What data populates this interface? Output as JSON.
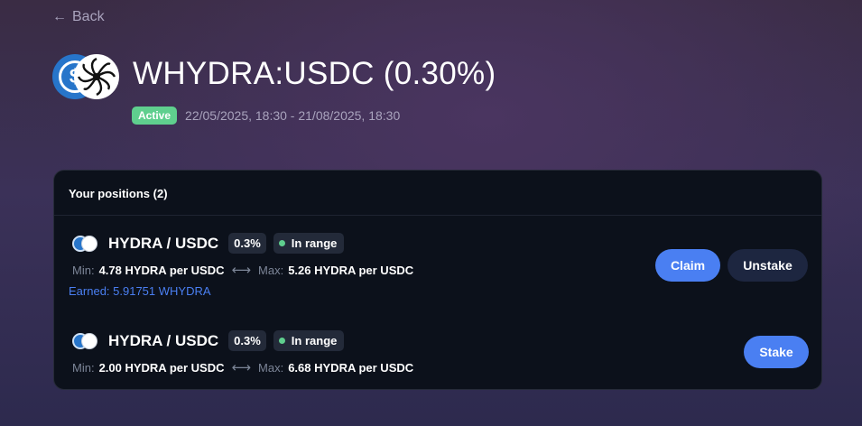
{
  "nav": {
    "back_label": "Back"
  },
  "pool": {
    "title": "WHYDRA:USDC (0.30%)",
    "status": "Active",
    "status_color": "#5fcf8e",
    "dates": "22/05/2025, 18:30 - 21/08/2025, 18:30"
  },
  "positions": {
    "header": "Your positions (2)",
    "items": [
      {
        "pair": "HYDRA / USDC",
        "fee": "0.3%",
        "range_status": "In range",
        "min_label": "Min:",
        "min_value": "4.78 HYDRA per USDC",
        "max_label": "Max:",
        "max_value": "5.26 HYDRA per USDC",
        "earned": "Earned: 5.91751 WHYDRA",
        "actions": {
          "claim": "Claim",
          "unstake": "Unstake"
        }
      },
      {
        "pair": "HYDRA / USDC",
        "fee": "0.3%",
        "range_status": "In range",
        "min_label": "Min:",
        "min_value": "2.00 HYDRA per USDC",
        "max_label": "Max:",
        "max_value": "6.68 HYDRA per USDC",
        "actions": {
          "stake": "Stake"
        }
      }
    ]
  },
  "icons": [
    "back-arrow-icon",
    "usdc-icon",
    "hydra-icon",
    "swap-arrows-icon",
    "status-dot-icon"
  ],
  "colors": {
    "accent": "#4a7ff2",
    "card_bg": "#0c111b",
    "success": "#5fcf8e"
  }
}
